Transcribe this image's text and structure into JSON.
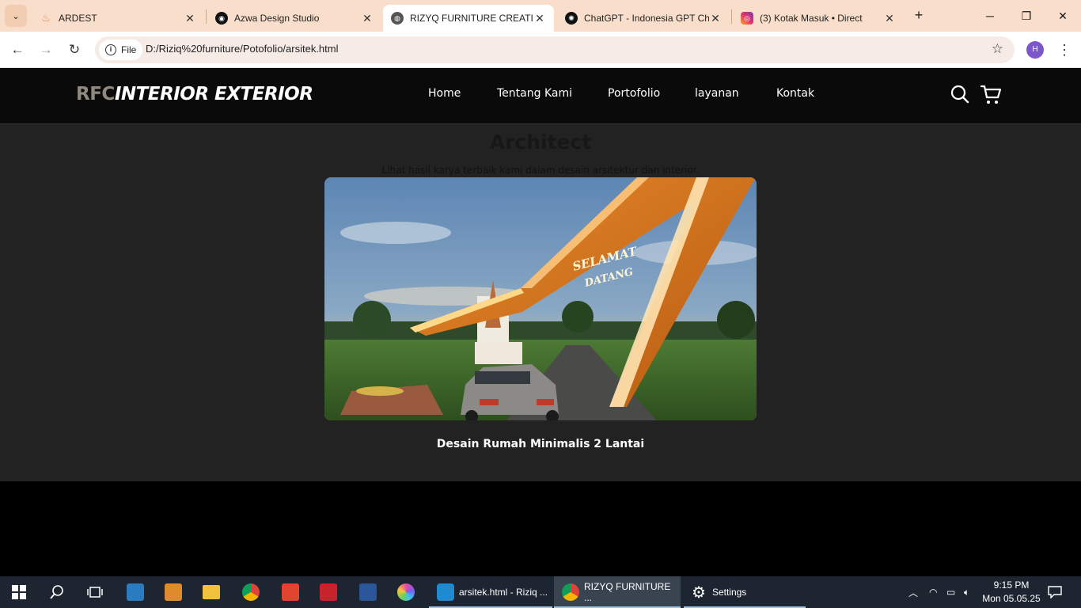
{
  "browser": {
    "tabs": [
      {
        "title": "ARDEST",
        "close": "✕",
        "icon": "flame-icon"
      },
      {
        "title": "Azwa Design Studio",
        "close": "✕",
        "icon": "circle-logo-icon"
      },
      {
        "title": "RIZYQ FURNITURE CREATION",
        "close": "✕",
        "icon": "globe-icon",
        "active": true
      },
      {
        "title": "ChatGPT - Indonesia GPT Ch",
        "close": "✕",
        "icon": "openai-icon"
      },
      {
        "title": "(3) Kotak Masuk • Direct",
        "close": "✕",
        "icon": "instagram-icon"
      }
    ],
    "new_tab": "+",
    "address": {
      "chip_label": "File",
      "url": "D:/Riziq%20furniture/Potofolio/arsitek.html"
    },
    "profile_initial": "H"
  },
  "site": {
    "logo_part1": "RFC",
    "logo_part2": "INTERIOR EXTERIOR",
    "menu": [
      "Home",
      "Tentang Kami",
      "Portofolio",
      "layanan",
      "Kontak"
    ],
    "page_title": "Architect",
    "page_subtitle": "Lihat hasil karya terbaik kami dalam desain arsitektur dan interior.",
    "gate_sign_line1": "SELAMAT",
    "gate_sign_line2": "DATANG",
    "card_caption": "Desain Rumah Minimalis 2 Lantai"
  },
  "taskbar": {
    "apps": [
      {
        "label": "arsitek.html - Riziq ...",
        "icon": "vscode-icon"
      },
      {
        "label": "RIZYQ FURNITURE ...",
        "icon": "chrome-icon",
        "active": true
      },
      {
        "label": "Settings",
        "icon": "settings-gear-icon"
      }
    ],
    "time": "9:15 PM",
    "date": "Mon 05.05.25"
  },
  "colors": {
    "tab_strip": "#f9dfcb",
    "site_header": "#0a0a0a",
    "content_bg": "#222222",
    "taskbar": "#1d2630",
    "gate_orange": "#d9761c"
  }
}
